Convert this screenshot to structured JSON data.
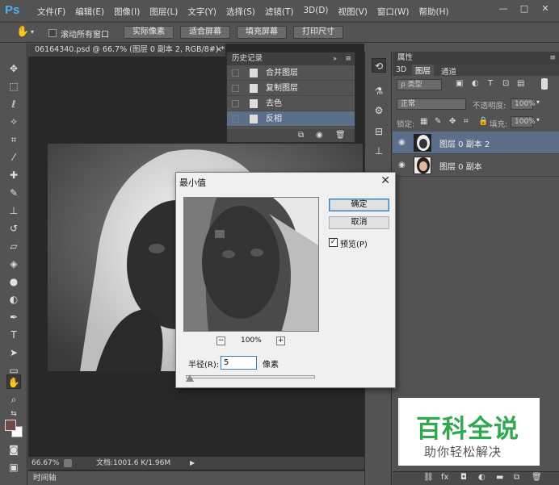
{
  "app": {
    "logo": "Ps"
  },
  "menu": [
    "文件(F)",
    "编辑(E)",
    "图像(I)",
    "图层(L)",
    "文字(Y)",
    "选择(S)",
    "滤镜(T)",
    "3D(D)",
    "视图(V)",
    "窗口(W)",
    "帮助(H)"
  ],
  "window_buttons": {
    "minimize": "—",
    "restore": "□",
    "close": "✕"
  },
  "options_bar": {
    "scroll_all_label": "滚动所有窗口",
    "actual_pixels": "实际像素",
    "fit_screen": "适合屏幕",
    "fill_screen": "填充屏幕",
    "print_size": "打印尺寸"
  },
  "document": {
    "tab_title": "06164340.psd @ 66.7% (图层 0 副本 2, RGB/8#) *",
    "close": "×",
    "zoom": "66.67%",
    "doc_info": "文档:1001.6 K/1.96M"
  },
  "timeline": {
    "label": "时间轴"
  },
  "history": {
    "title": "历史记录",
    "items": [
      {
        "label": "合并图层",
        "selected": false
      },
      {
        "label": "复制图层",
        "selected": false
      },
      {
        "label": "去色",
        "selected": false
      },
      {
        "label": "反相",
        "selected": true
      }
    ]
  },
  "layers_panel": {
    "properties_title": "属性",
    "tabs": [
      "3D",
      "图层",
      "通道"
    ],
    "filter_kind": "ρ 类型",
    "blend_mode": "正常",
    "opacity_label": "不透明度:",
    "opacity_value": "100%",
    "lock_label": "锁定:",
    "fill_label": "填充:",
    "fill_value": "100%",
    "layers": [
      {
        "name": "图层 0 副本 2",
        "selected": true
      },
      {
        "name": "图层 0 副本",
        "selected": false
      }
    ]
  },
  "dialog": {
    "title": "最小值",
    "close": "✕",
    "ok": "确定",
    "cancel": "取消",
    "preview_label": "预览(P)",
    "preview_checked": true,
    "zoom_minus": "−",
    "zoom_value": "100%",
    "zoom_plus": "+",
    "radius_label": "半径(R):",
    "radius_value": "5",
    "radius_unit": "像素",
    "radius_slider_fraction": 0.0
  },
  "watermark": {
    "main": "百科全说",
    "sub": "助你轻松解决"
  },
  "colors": {
    "accent": "#5c6f8a",
    "watermark_green": "#2fa84f",
    "ps_blue": "#4fb0f5"
  }
}
